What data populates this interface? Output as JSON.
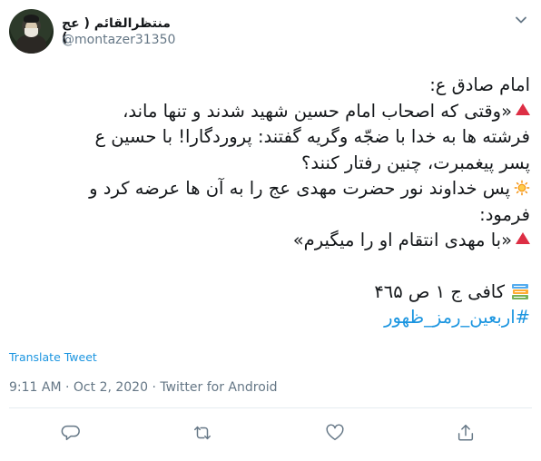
{
  "user": {
    "display_name": "منتظرالقائم ( عج )",
    "handle": "@montazer31350",
    "avatar_icon": "avatar-portrait"
  },
  "tweet": {
    "lines": [
      "امام صادق ع:",
      "«وقتی که اصحاب امام حسین شهید شدند و تنها ماند،",
      "فرشته ها به خدا با ضجّه وگریه گفتند: پروردگارا! با حسین ع",
      "پسر پیغمبرت، چنین رفتار کنند؟",
      "پس خداوند نور حضرت مهدی عج را به آن ها عرضه کرد و",
      "فرمود:",
      "«با مهدی انتقام او را میگیرم»",
      "کافی ج ۱ ص ۴٦۵",
      "#اربعین_رمز_ظهور"
    ]
  },
  "translate_label": "Translate Tweet",
  "meta": {
    "time": "9:11 AM",
    "separator1": " · ",
    "date": "Oct 2, 2020",
    "separator2": " · ",
    "source": "Twitter for Android"
  },
  "icons": {
    "more": "chevron-down-icon",
    "reply": "reply-icon",
    "retweet": "retweet-icon",
    "like": "heart-icon",
    "share": "share-icon",
    "triangle": "red-triangle-icon",
    "sun": "sun-icon",
    "books": "books-icon"
  },
  "colors": {
    "text": "#14171a",
    "secondary": "#657786",
    "link": "#1b95e0",
    "triangle": "#dd2e44"
  }
}
